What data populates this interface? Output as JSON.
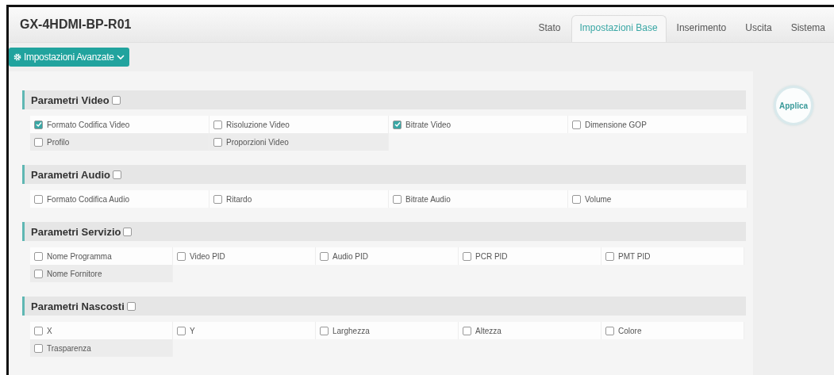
{
  "header": {
    "title": "GX-4HDMI-BP-R01",
    "tabs": [
      {
        "label": "Stato",
        "selected": false
      },
      {
        "label": "Impostazioni Base",
        "selected": true
      },
      {
        "label": "Inserimento",
        "selected": false
      },
      {
        "label": "Uscita",
        "selected": false
      },
      {
        "label": "Sistema",
        "selected": false
      }
    ]
  },
  "advanced_button": {
    "label": "Impostazioni Avanzate"
  },
  "sections": [
    {
      "title": "Parametri Video",
      "checked": false,
      "rows": [
        [
          {
            "label": "Formato Codifica Video",
            "checked": true
          },
          {
            "label": "Risoluzione Video",
            "checked": false
          },
          {
            "label": "Bitrate Video",
            "checked": true
          },
          {
            "label": "Dimensione GOP",
            "checked": false
          }
        ],
        [
          {
            "label": "Profilo",
            "checked": false
          },
          {
            "label": "Proporzioni Video",
            "checked": false
          }
        ]
      ]
    },
    {
      "title": "Parametri Audio",
      "checked": false,
      "rows": [
        [
          {
            "label": "Formato Codifica Audio",
            "checked": false
          },
          {
            "label": "Ritardo",
            "checked": false
          },
          {
            "label": "Bitrate Audio",
            "checked": false
          },
          {
            "label": "Volume",
            "checked": false
          }
        ]
      ]
    },
    {
      "title": "Parametri Servizio",
      "checked": false,
      "rows": [
        [
          {
            "label": "Nome Programma",
            "checked": false
          },
          {
            "label": "Video PID",
            "checked": false
          },
          {
            "label": "Audio PID",
            "checked": false
          },
          {
            "label": "PCR PID",
            "checked": false
          },
          {
            "label": "PMT PID",
            "checked": false
          }
        ],
        [
          {
            "label": "Nome Fornitore",
            "checked": false
          }
        ]
      ]
    },
    {
      "title": "Parametri Nascosti",
      "checked": false,
      "rows": [
        [
          {
            "label": "X",
            "checked": false
          },
          {
            "label": "Y",
            "checked": false
          },
          {
            "label": "Larghezza",
            "checked": false
          },
          {
            "label": "Altezza",
            "checked": false
          },
          {
            "label": "Colore",
            "checked": false
          }
        ],
        [
          {
            "label": "Trasparenza",
            "checked": false
          }
        ]
      ]
    }
  ],
  "apply_button": {
    "label": "Applica"
  }
}
